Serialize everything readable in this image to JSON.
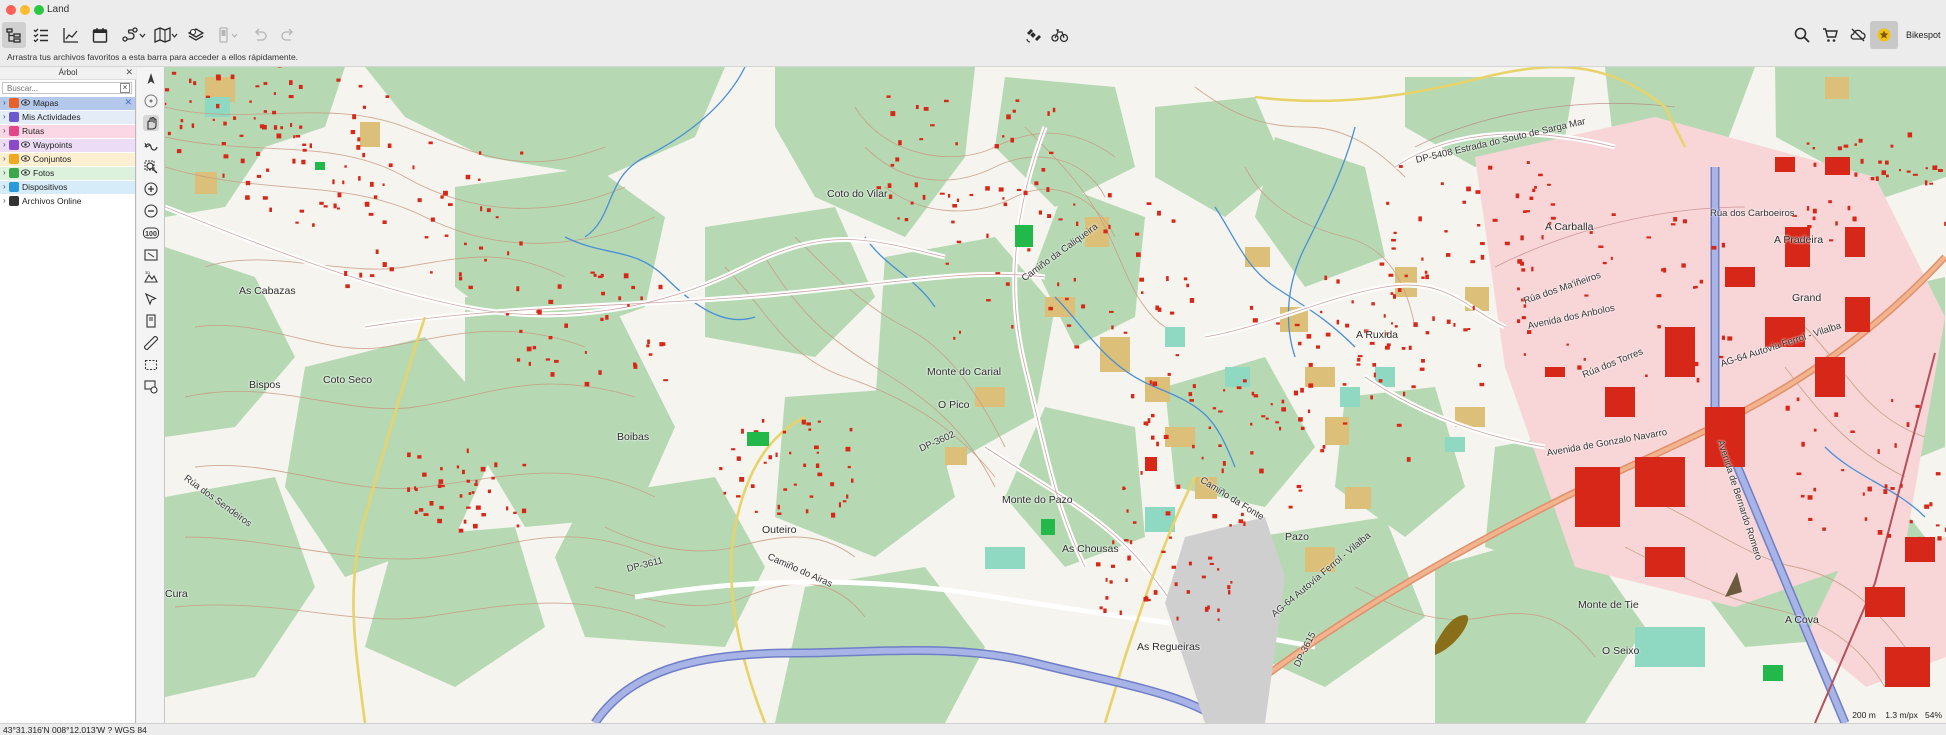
{
  "window": {
    "title": "Land"
  },
  "toolbar": {
    "buttons": [
      {
        "name": "tree-view",
        "icon": "tree-view-icon",
        "active": true
      },
      {
        "name": "list-view",
        "icon": "list-view-icon"
      },
      {
        "name": "profile-chart",
        "icon": "chart-icon"
      },
      {
        "name": "calendar",
        "icon": "calendar-icon"
      },
      {
        "name": "route",
        "icon": "route-icon"
      },
      {
        "name": "map-select",
        "icon": "map-icon"
      },
      {
        "name": "layers",
        "icon": "layers-icon"
      },
      {
        "name": "device",
        "icon": "device-icon",
        "disabled": true
      },
      {
        "name": "undo",
        "icon": "undo-icon",
        "disabled": true
      },
      {
        "name": "redo",
        "icon": "redo-icon",
        "disabled": true
      }
    ],
    "center_buttons": [
      "satellite-icon",
      "bike-sync-icon"
    ],
    "right_buttons": [
      "search-icon",
      "cart-icon",
      "cloud-off-icon"
    ],
    "profile_name": "Bikespot"
  },
  "favorites_bar": {
    "hint": "Arrastra tus archivos favoritos a esta barra para acceder a ellos rápidamente."
  },
  "sidebar": {
    "title": "Árbol",
    "search_placeholder": "Buscar...",
    "items": [
      {
        "label": "Mapas",
        "color": "#e8602a",
        "bg": "#b4c8ec",
        "eye": true,
        "selected": true
      },
      {
        "label": "Mis Actividades",
        "color": "#6a5acd",
        "bg": "#e4ecf8",
        "eye": false
      },
      {
        "label": "Rutas",
        "color": "#e0488a",
        "bg": "#fbd7e6",
        "eye": false
      },
      {
        "label": "Waypoints",
        "color": "#8a49c8",
        "bg": "#ecdcf6",
        "eye": true
      },
      {
        "label": "Conjuntos",
        "color": "#f0a820",
        "bg": "#fdf0d2",
        "eye": true
      },
      {
        "label": "Fotos",
        "color": "#3aa84a",
        "bg": "#dcf2dd",
        "eye": true
      },
      {
        "label": "Dispositivos",
        "color": "#2a9ad8",
        "bg": "#d6ecf8",
        "eye": false
      },
      {
        "label": "Archivos Online",
        "color": "#333333",
        "bg": "#ffffff",
        "eye": false
      }
    ]
  },
  "map_tools": [
    "north-arrow-icon",
    "compass-icon",
    "hand-pan-icon",
    "route-draw-icon",
    "zoom-box-icon",
    "zoom-in-icon",
    "zoom-out-icon",
    "zoom-100-icon",
    "fit-screen-icon",
    "3d-view-icon",
    "select-arrow-icon",
    "book-icon",
    "ruler-icon",
    "select-rect-icon",
    "map-settings-icon"
  ],
  "map": {
    "labels": {
      "coto_do_vilar": "Coto do Vilar",
      "as_cabazas": "As Cabazas",
      "bispos": "Bispos",
      "coto_seco": "Coto Seco",
      "monte_do_carial": "Monte do Carial",
      "o_pico": "O Pico",
      "boibas": "Boibas",
      "monte_do_pazo": "Monte do Pazo",
      "outeiro": "Outeiro",
      "as_chousas": "As Chousas",
      "as_regueiras": "As Regueiras",
      "a_carballa": "A Carballa",
      "a_pradeira": "A Pradeira",
      "a_ruxida": "A Ruxida",
      "pazo": "Pazo",
      "monte_de_tie": "Monte de Tie",
      "o_seixo": "O Seixo",
      "a_cova": "A Cova",
      "cura": "Cura",
      "granda": "Grand"
    },
    "roads": {
      "camino_caliqueira": "Camiño da Caliqueira",
      "dp_5408": "DP-5408 Estrada do Souto de Sarga Mar",
      "rua_carboeiros": "Rúa dos Carboeiros",
      "rua_martineiros": "Rúa dos Ma'iñeiros",
      "avenida_ambanas": "Avenida dos Anbolos",
      "rua_torres": "Rúa dos Torres",
      "ag64_autovia": "AG-64 Autovía Ferrol - Vilalba",
      "avenida_gonzalo": "Avenida de Gonzalo Navarro",
      "avenida_bernardo": "Avenida de Bernardo Romero",
      "camino_fonte": "Camiño da Fonte",
      "dp_3602": "DP-3602",
      "dp_3611": "DP-3611",
      "camino_airas": "Camiño do Airas",
      "rua_sendeiros": "Rúa dos Sendeiros",
      "ag64_lower": "AG-64 Autovía Ferrol - Vilalba",
      "dp_3615": "DP-3615"
    },
    "scale": "200 m",
    "resolution": "1.3 m/px",
    "zoom": "54%"
  },
  "status_bar": {
    "coords": "43°31.316'N 008°12.013'W  ?  WGS 84"
  },
  "colors": {
    "forest": "#b6d9b4",
    "contour": "#c89c84",
    "building": "#d62718",
    "industrial": "#f8d6d8",
    "farm": "#dcc07a",
    "water": "#4b8fd6",
    "motorway": "#8b9ad6"
  }
}
